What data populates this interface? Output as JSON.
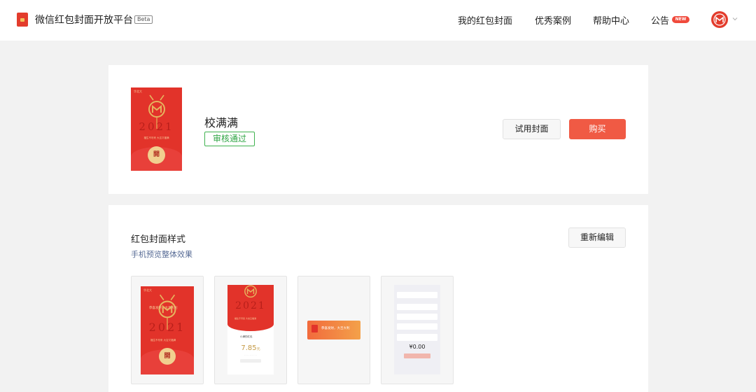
{
  "header": {
    "brand_title": "微信红包封面开放平台",
    "beta_label": "Beta",
    "nav": [
      {
        "label": "我的红包封面"
      },
      {
        "label": "优秀案例"
      },
      {
        "label": "帮助中心"
      },
      {
        "label": "公告"
      }
    ],
    "new_badge": "NEW",
    "avatar_icon": "university-logo-icon",
    "dropdown_icon": "chevron-down-icon"
  },
  "cover_card": {
    "name": "校满满",
    "status": "审核通过",
    "cover_thumb": {
      "header_text": "华北大",
      "year": "2021",
      "subtitle": "福生不尽来 大吉又福满",
      "seal_text": "開"
    },
    "try_button": "试用封面",
    "buy_button": "购买"
  },
  "style_section": {
    "title": "红包封面样式",
    "subtitle": "手机预览整体效果",
    "reedit_button": "重新编辑",
    "previews": {
      "p1": {
        "header_text": "华北大",
        "year": "2021",
        "overlay_text": "恭喜发财，大吉大利",
        "subtitle": "福生不尽来 大吉又福满",
        "seal_text": "開"
      },
      "p2": {
        "year": "2021",
        "subtitle": "福生不尽来 大吉又福满",
        "sender": "小满的红包",
        "amount": "7.85",
        "amount_unit": "元"
      },
      "p3": {
        "message": "恭喜发财，大吉大利"
      },
      "p4": {
        "money": "¥0.00"
      }
    }
  },
  "colors": {
    "accent": "#f05a44",
    "approved": "#3fb24f",
    "link": "#576b95",
    "cover_red": "#e2332a"
  }
}
